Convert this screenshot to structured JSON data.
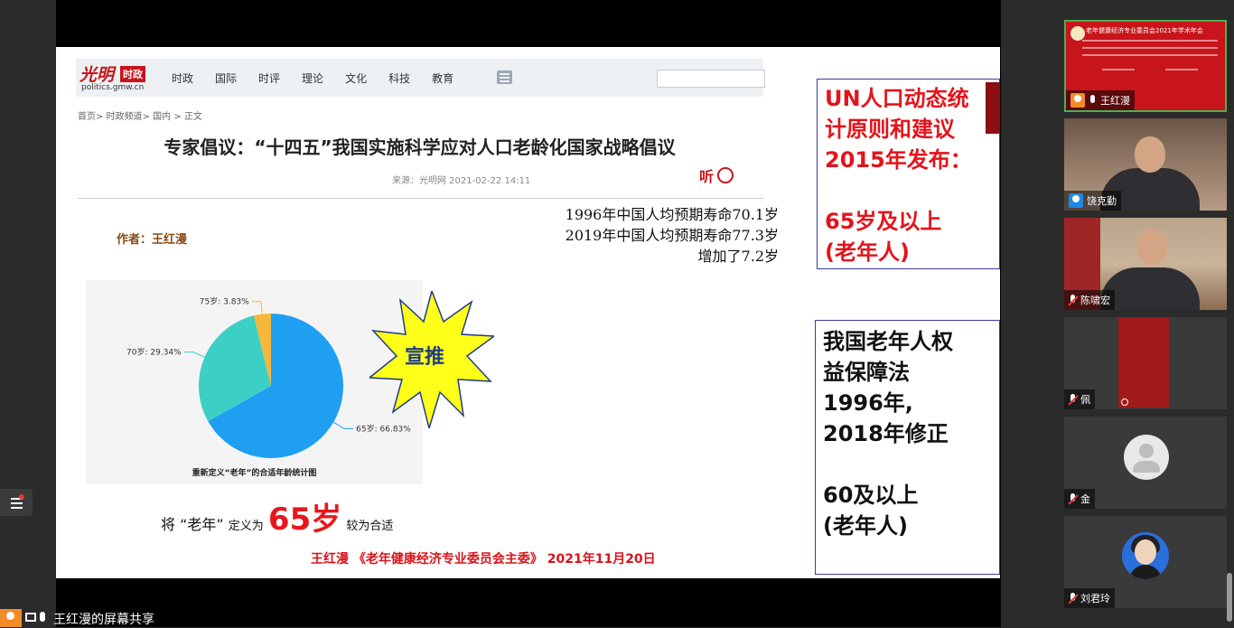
{
  "stage": {
    "nav": {
      "logo": "光明时政",
      "logo_main": "光明",
      "logo_tag": "时政",
      "logo_url": "politics.gmw.cn",
      "items": [
        "时政",
        "国际",
        "时评",
        "理论",
        "文化",
        "科技",
        "教育"
      ]
    },
    "breadcrumb": "首页> 时政频道> 国内 > 正文",
    "article_title": "专家倡议：“十四五”我国实施科学应对人口老龄化国家战略倡议",
    "source": "来源：光明网   2021-02-22 14:11",
    "listen_label": "听",
    "author": "作者：王红漫",
    "life_expectancy": [
      "1996年中国人均预期寿命70.1岁",
      "2019年中国人均预期寿命77.3岁",
      "增加了7.2岁"
    ],
    "chart_data": {
      "type": "pie",
      "title": "重新定义“老年”的合适年龄统计图",
      "slices": [
        {
          "label": "65岁",
          "value": 66.83,
          "color": "#1e9ff2"
        },
        {
          "label": "70岁",
          "value": 29.34,
          "color": "#3ccfc6"
        },
        {
          "label": "75岁",
          "value": 3.83,
          "color": "#f5b83a"
        }
      ],
      "labels": [
        "65岁: 66.83%",
        "70岁: 29.34%",
        "75岁: 3.83%"
      ]
    },
    "starburst_label": "宣推",
    "define": {
      "pre": "将",
      "quoted": "“老年”",
      "mid": "定义为",
      "big": "65岁",
      "post": "较为合适"
    },
    "footer": "王红漫 《老年健康经济专业委员会主委》 2021年11月20日",
    "box_un": "UN人口动态统\n计原则和建议\n2015年发布：\n\n65岁及以上\n(老年人)",
    "box_cn": "我国老年人权\n益保障法\n1996年,\n2018年修正\n\n60及以上\n(老年人)"
  },
  "share_bar": {
    "text": "王红漫的屏幕共享"
  },
  "participants": [
    {
      "name": "王红漫",
      "muted": false,
      "user_color": "#f28c28",
      "tile_title": "老年健康经济专业委员会2021年学术年会"
    },
    {
      "name": "饶克勤",
      "muted": false,
      "user_color": "#1e88e5"
    },
    {
      "name": "陈啸宏",
      "muted": true
    },
    {
      "name": "佩",
      "muted": true
    },
    {
      "name": "金",
      "muted": true
    },
    {
      "name": "刘君玲",
      "muted": true
    }
  ]
}
